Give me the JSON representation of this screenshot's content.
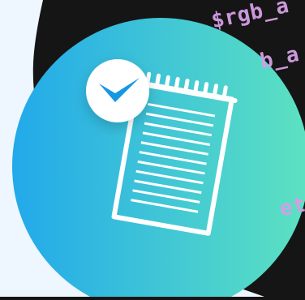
{
  "code_snippet": {
    "line_1": "$rgb_a",
    "line_2": "b_a",
    "line_3": "et"
  },
  "colors": {
    "dark_background": "#151515",
    "light_panel": "#eef7ff",
    "gradient_start": "#22a9ea",
    "gradient_end": "#5de2c1",
    "notepad_stroke": "#ffffff",
    "badge_fill": "#ffffff",
    "check_color": "#1897e4",
    "code_color": "#d59ee6"
  },
  "icons": {
    "main": "notepad-icon",
    "badge": "checkmark-icon"
  }
}
